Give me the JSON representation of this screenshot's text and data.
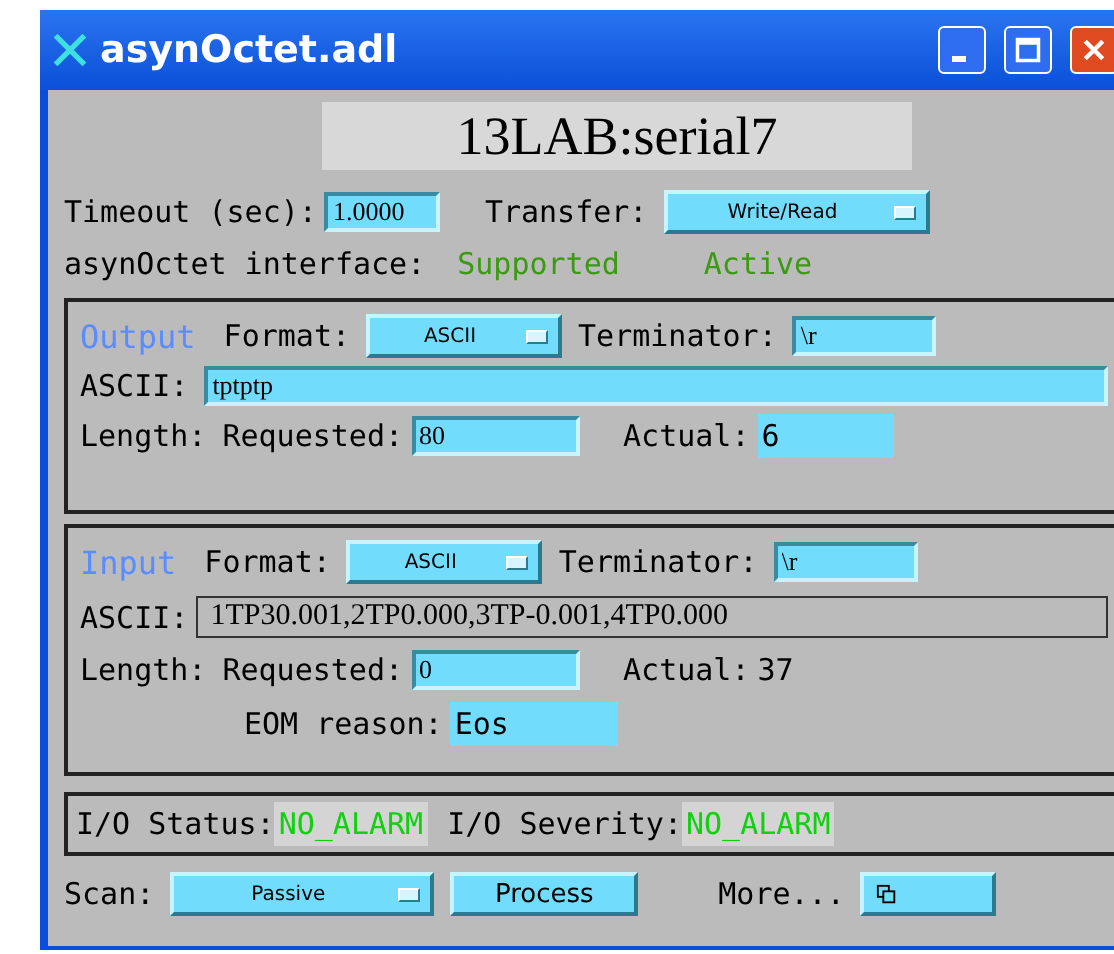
{
  "window": {
    "title": "asynOctet.adl"
  },
  "device": {
    "name": "13LAB:serial7"
  },
  "timeout": {
    "label": "Timeout (sec):",
    "value": "1.0000"
  },
  "transfer": {
    "label": "Transfer:",
    "value": "Write/Read"
  },
  "interface": {
    "label": "asynOctet interface:",
    "supported": "Supported",
    "active": "Active"
  },
  "output": {
    "title": "Output",
    "format_label": "Format:",
    "format": "ASCII",
    "terminator_label": "Terminator:",
    "terminator": "\\r",
    "ascii_label": "ASCII:",
    "ascii": "tptptp",
    "length_label": "Length:",
    "requested_label": "Requested:",
    "requested": "80",
    "actual_label": "Actual:",
    "actual": "6"
  },
  "input": {
    "title": "Input",
    "format_label": "Format:",
    "format": "ASCII",
    "terminator_label": "Terminator:",
    "terminator": "\\r",
    "ascii_label": "ASCII:",
    "ascii": "1TP30.001,2TP0.000,3TP-0.001,4TP0.000",
    "length_label": "Length:",
    "requested_label": "Requested:",
    "requested": "0",
    "actual_label": "Actual:",
    "actual": "37",
    "eom_label": "EOM reason:",
    "eom": "Eos"
  },
  "status": {
    "status_label": "I/O Status:",
    "status": "NO_ALARM",
    "severity_label": "I/O Severity:",
    "severity": "NO_ALARM"
  },
  "scan": {
    "label": "Scan:",
    "value": "Passive"
  },
  "process_button": "Process",
  "more": {
    "label": "More..."
  }
}
